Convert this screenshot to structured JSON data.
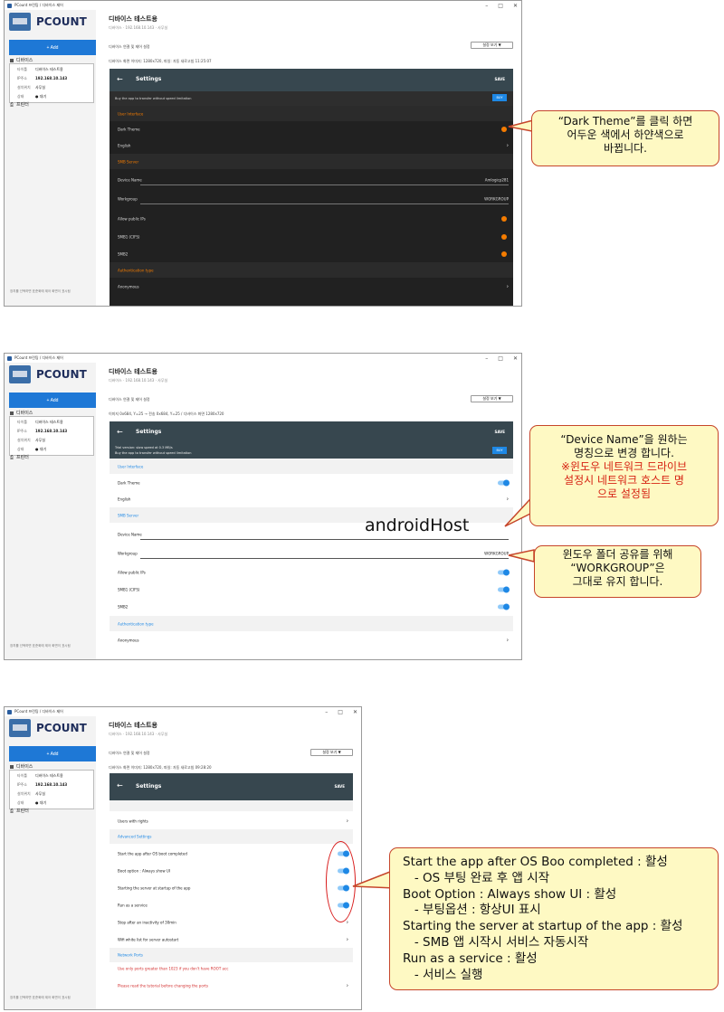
{
  "app": {
    "window_title": "PCount 프린팅 / 디바이스 제어",
    "logo_text": "PCOUNT",
    "add_label": "+ Add",
    "devices_label": "디바이스",
    "printer_label": "프린터",
    "footer_text": "장치를 선택하면 표준화에 제어 화면이 표시됨",
    "device": {
      "name_label": "타이틀",
      "name": "디바이스 테스트용",
      "addr_label": "IP주소",
      "addr": "192.168.10.143",
      "loc_label": "설치위치",
      "loc": "사무실",
      "state_label": "상태",
      "state": "● 대기"
    },
    "device_title": "디바이스 테스트용",
    "device_sub": "디바이스 · 192.168.10.143 · 사무실",
    "connect_label": "디바이스 연결 및 제어 설정",
    "view_button": "설정 보기 ▼"
  },
  "panels": [
    {
      "screen_info": "디바이스 화면 이미지: 1280x720, 파일: 자동 새로고침 11:25:07",
      "settings_title": "Settings",
      "save": "SAVE",
      "banner_line1": "",
      "banner_line2": "Buy the app to transfer without speed limitation",
      "buy": "BUY",
      "rows": {
        "ui_section": "User Interface",
        "dark_theme": "Dark Theme",
        "language": "English",
        "smb_section": "SMB Server",
        "device_name": "Device Name",
        "device_name_value": "Amlogicp281",
        "workgroup": "Workgroup",
        "workgroup_value": "WORKGROUP",
        "public_ips": "Allow public IPs",
        "smb1": "SMB1 (CIFS)",
        "smb2": "SMB2",
        "auth_section": "Authentication type",
        "anonymous": "Anonymous"
      },
      "callout": [
        "“Dark Theme”를 클릭 하면",
        "어두운 색에서 하얀색으로",
        "바뀝니다."
      ]
    },
    {
      "screen_info": "이미지 0x684, Y=25 → 전송 0x684, Y=25 / 디바이스 화면 1280x720",
      "settings_title": "Settings",
      "save": "SAVE",
      "banner_line1": "Trial version: slow speed at 0.3 MB/s",
      "banner_line2": "Buy the app to transfer without speed limitation",
      "buy": "BUY",
      "rows": {
        "ui_section": "User Interface",
        "dark_theme": "Dark Theme",
        "language": "English",
        "smb_section": "SMB Server",
        "device_name": "Device Name",
        "device_name_value": "androidHost",
        "workgroup": "Workgroup",
        "workgroup_value": "WORKGROUP",
        "public_ips": "Allow public IPs",
        "smb1": "SMB1 (CIFS)",
        "smb2": "SMB2",
        "auth_section": "Authentication type",
        "anonymous": "Anonymous"
      },
      "callout_a": [
        "“Device Name”을 원하는",
        "명칭으로 변경 합니다."
      ],
      "callout_a_red": [
        "※윈도우 네트워크 드라이브",
        "설정시 네트워크 호스트 명",
        "으로 설정됨"
      ],
      "callout_b": [
        "윈도우 폴더 공유를 위해",
        "“WORKGROUP”은",
        "그대로 유지 합니다."
      ]
    },
    {
      "screen_info": "디바이스 화면 이미지: 1280x720, 파일: 자동 새로고침 09:28:20",
      "settings_title": "Settings",
      "save": "SAVE",
      "rows": {
        "users_rights": "Users with rights",
        "adv_section": "Advanced Settings",
        "start_after_boot": "Start the app after OS boot completed",
        "boot_option": "Boot option : Always show UI",
        "start_server": "Starting the server at startup of the app",
        "run_service": "Run as a service",
        "stop_after": "Stop after an inactivity of 30min",
        "wifi_whitelist": "Wifi white list for server autostart",
        "net_section": "Network Ports",
        "ports_warning": "Use only ports greater than 1023 if you don't have ROOT acc",
        "read_tutorial": "Please read the tutorial before changing the ports"
      },
      "callout": [
        "Start the app after OS Boo completed : 활성",
        "   - OS 부팅 완료 후 앱 시작",
        "Boot Option : Always show UI : 활성",
        "   - 부팅옵션 : 항상UI 표시",
        "Starting the server at startup of the app : 활성",
        "   - SMB 앱 시작시 서비스 자동시작",
        "Run as a service : 활성",
        "   - 서비스 실행"
      ]
    }
  ]
}
